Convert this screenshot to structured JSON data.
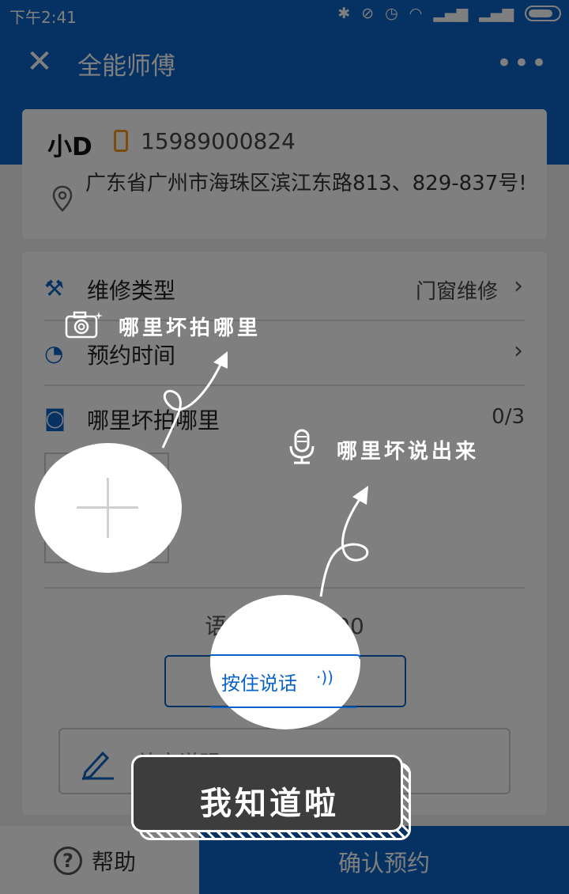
{
  "status_bar": {
    "time": "下午2:41"
  },
  "header": {
    "title": "全能师傅"
  },
  "contact": {
    "name": "小D",
    "phone": "15989000824",
    "address": "广东省广州市海珠区滨江东路813、829-837号!"
  },
  "form": {
    "repair_type": {
      "label": "维修类型",
      "value": "门窗维修"
    },
    "appointment": {
      "label": "预约时间"
    },
    "photos": {
      "label": "哪里坏拍哪里",
      "count": "0/3"
    },
    "voice": {
      "label": "语音描述 00:00",
      "button_label": "按住说话"
    },
    "note": {
      "label": "补充说明"
    }
  },
  "bottom_bar": {
    "help_label": "帮助",
    "confirm_label": "确认预约"
  },
  "tutorial": {
    "photo_hint": "哪里坏拍哪里",
    "voice_hint": "哪里坏说出来",
    "got_it_label": "我知道啦"
  },
  "colors": {
    "primary": "#0a63c7",
    "phone_icon": "#f39a1b",
    "overlay": "rgba(0,0,0,0.5)"
  }
}
